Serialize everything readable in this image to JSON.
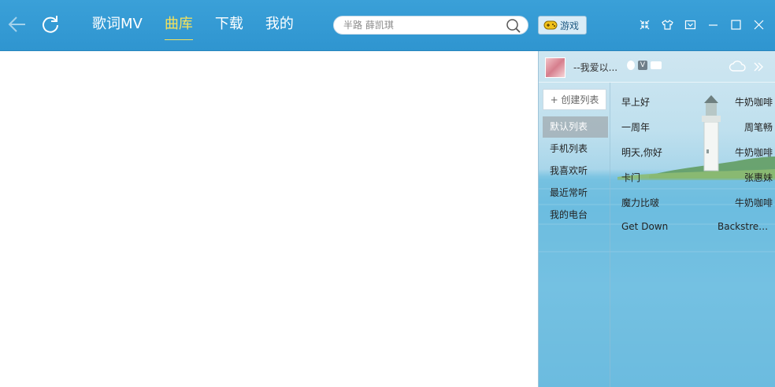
{
  "topbar": {
    "tabs": [
      {
        "label": "歌词MV",
        "active": false
      },
      {
        "label": "曲库",
        "active": true
      },
      {
        "label": "下载",
        "active": false
      },
      {
        "label": "我的",
        "active": false
      }
    ],
    "search_placeholder": "半路 薛凯琪",
    "game_label": "游戏",
    "accent_color": "#f7e35a",
    "bar_color": "#3aa0d8"
  },
  "icons": {
    "back": "back-arrow-icon",
    "refresh": "refresh-icon",
    "search": "search-icon",
    "game": "gamepad-icon",
    "window": [
      "mini-mode-icon",
      "skin-icon",
      "menu-icon",
      "minimize-icon",
      "maximize-icon",
      "close-icon"
    ]
  },
  "panel": {
    "username": "--我爱以...",
    "badge_v": "V",
    "create_label": "+ 创建列表",
    "lists": [
      {
        "label": "默认列表",
        "active": true
      },
      {
        "label": "手机列表",
        "active": false
      },
      {
        "label": "我喜欢听",
        "active": false
      },
      {
        "label": "最近常听",
        "active": false
      },
      {
        "label": "我的电台",
        "active": false
      }
    ],
    "songs": [
      {
        "title": "早上好",
        "artist": "牛奶咖啡"
      },
      {
        "title": "一周年",
        "artist": "周笔畅"
      },
      {
        "title": "明天,你好",
        "artist": "牛奶咖啡"
      },
      {
        "title": "卡门",
        "artist": "张惠妹"
      },
      {
        "title": "魔力比啵",
        "artist": "牛奶咖啡"
      },
      {
        "title": "Get Down",
        "artist": "Backstreet Boys"
      }
    ]
  }
}
